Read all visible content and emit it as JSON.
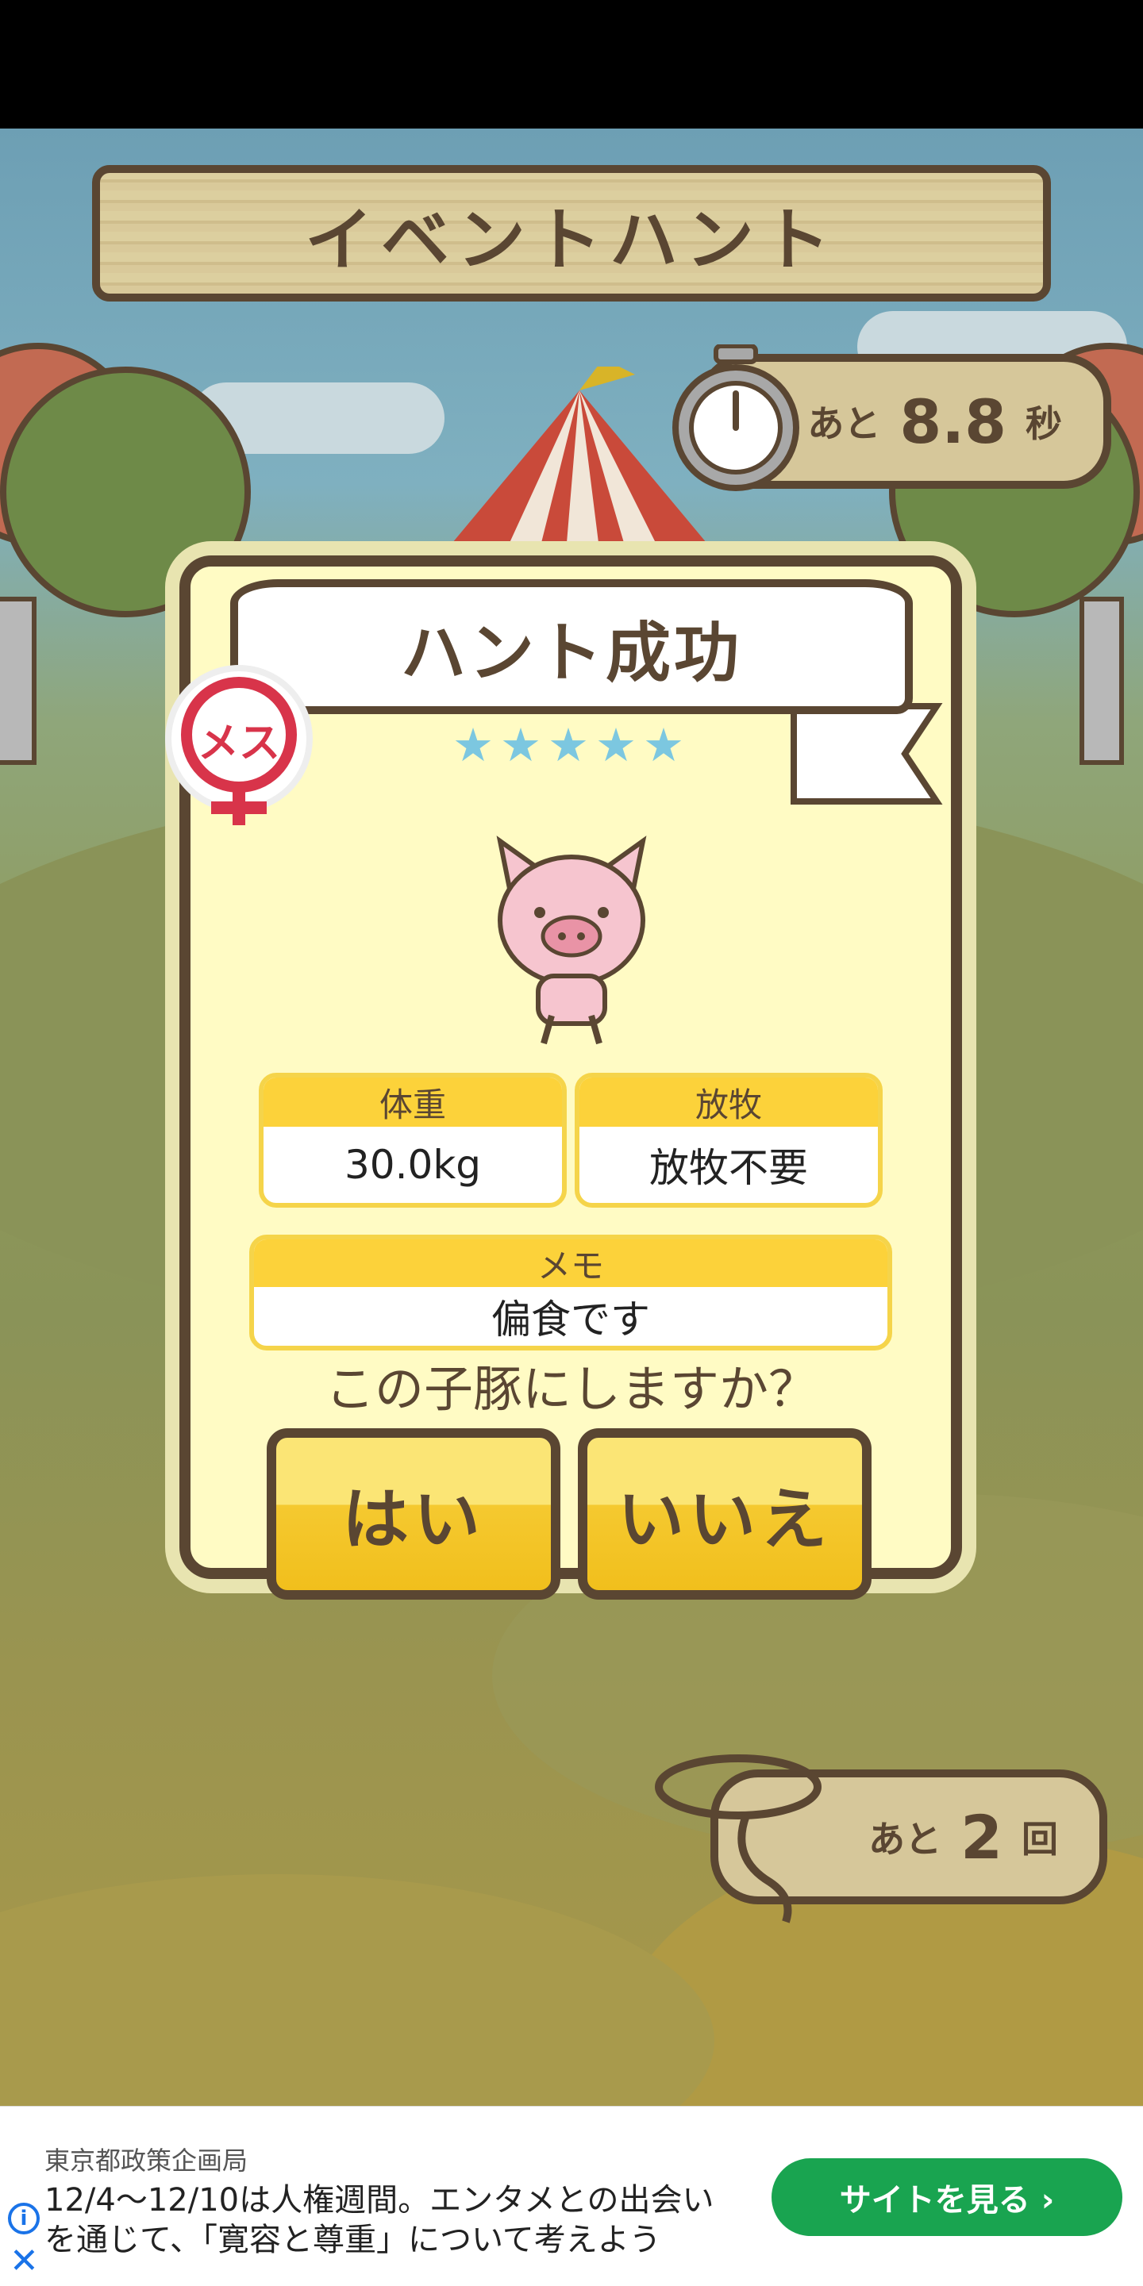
{
  "header": {
    "title": "イベントハント"
  },
  "timer": {
    "prefix": "あと",
    "value": "8.8",
    "unit": "秒"
  },
  "result": {
    "banner": "ハント成功",
    "stars": "★★★★★",
    "gender_label": "メス",
    "weight": {
      "label": "体重",
      "value": "30.0kg"
    },
    "pasture": {
      "label": "放牧",
      "value": "放牧不要"
    },
    "memo": {
      "label": "メモ",
      "value": "偏食です"
    },
    "question": "この子豚にしますか？",
    "yes_label": "はい",
    "no_label": "いいえ"
  },
  "attempts": {
    "prefix": "あと",
    "value": "2",
    "unit": "回"
  },
  "ad": {
    "source": "東京都政策企画局",
    "line1": "12/4〜12/10は人権週間。エンタメとの出会い",
    "line2": "を通じて、「寛容と尊重」について考えよう",
    "cta": "サイトを見る ›",
    "info_icon": "i",
    "close_icon": "✕"
  },
  "colors": {
    "wood_border": "#5a4632",
    "button_yellow": "#f5c930",
    "ad_cta": "#19a450",
    "star": "#7cc7e0"
  }
}
